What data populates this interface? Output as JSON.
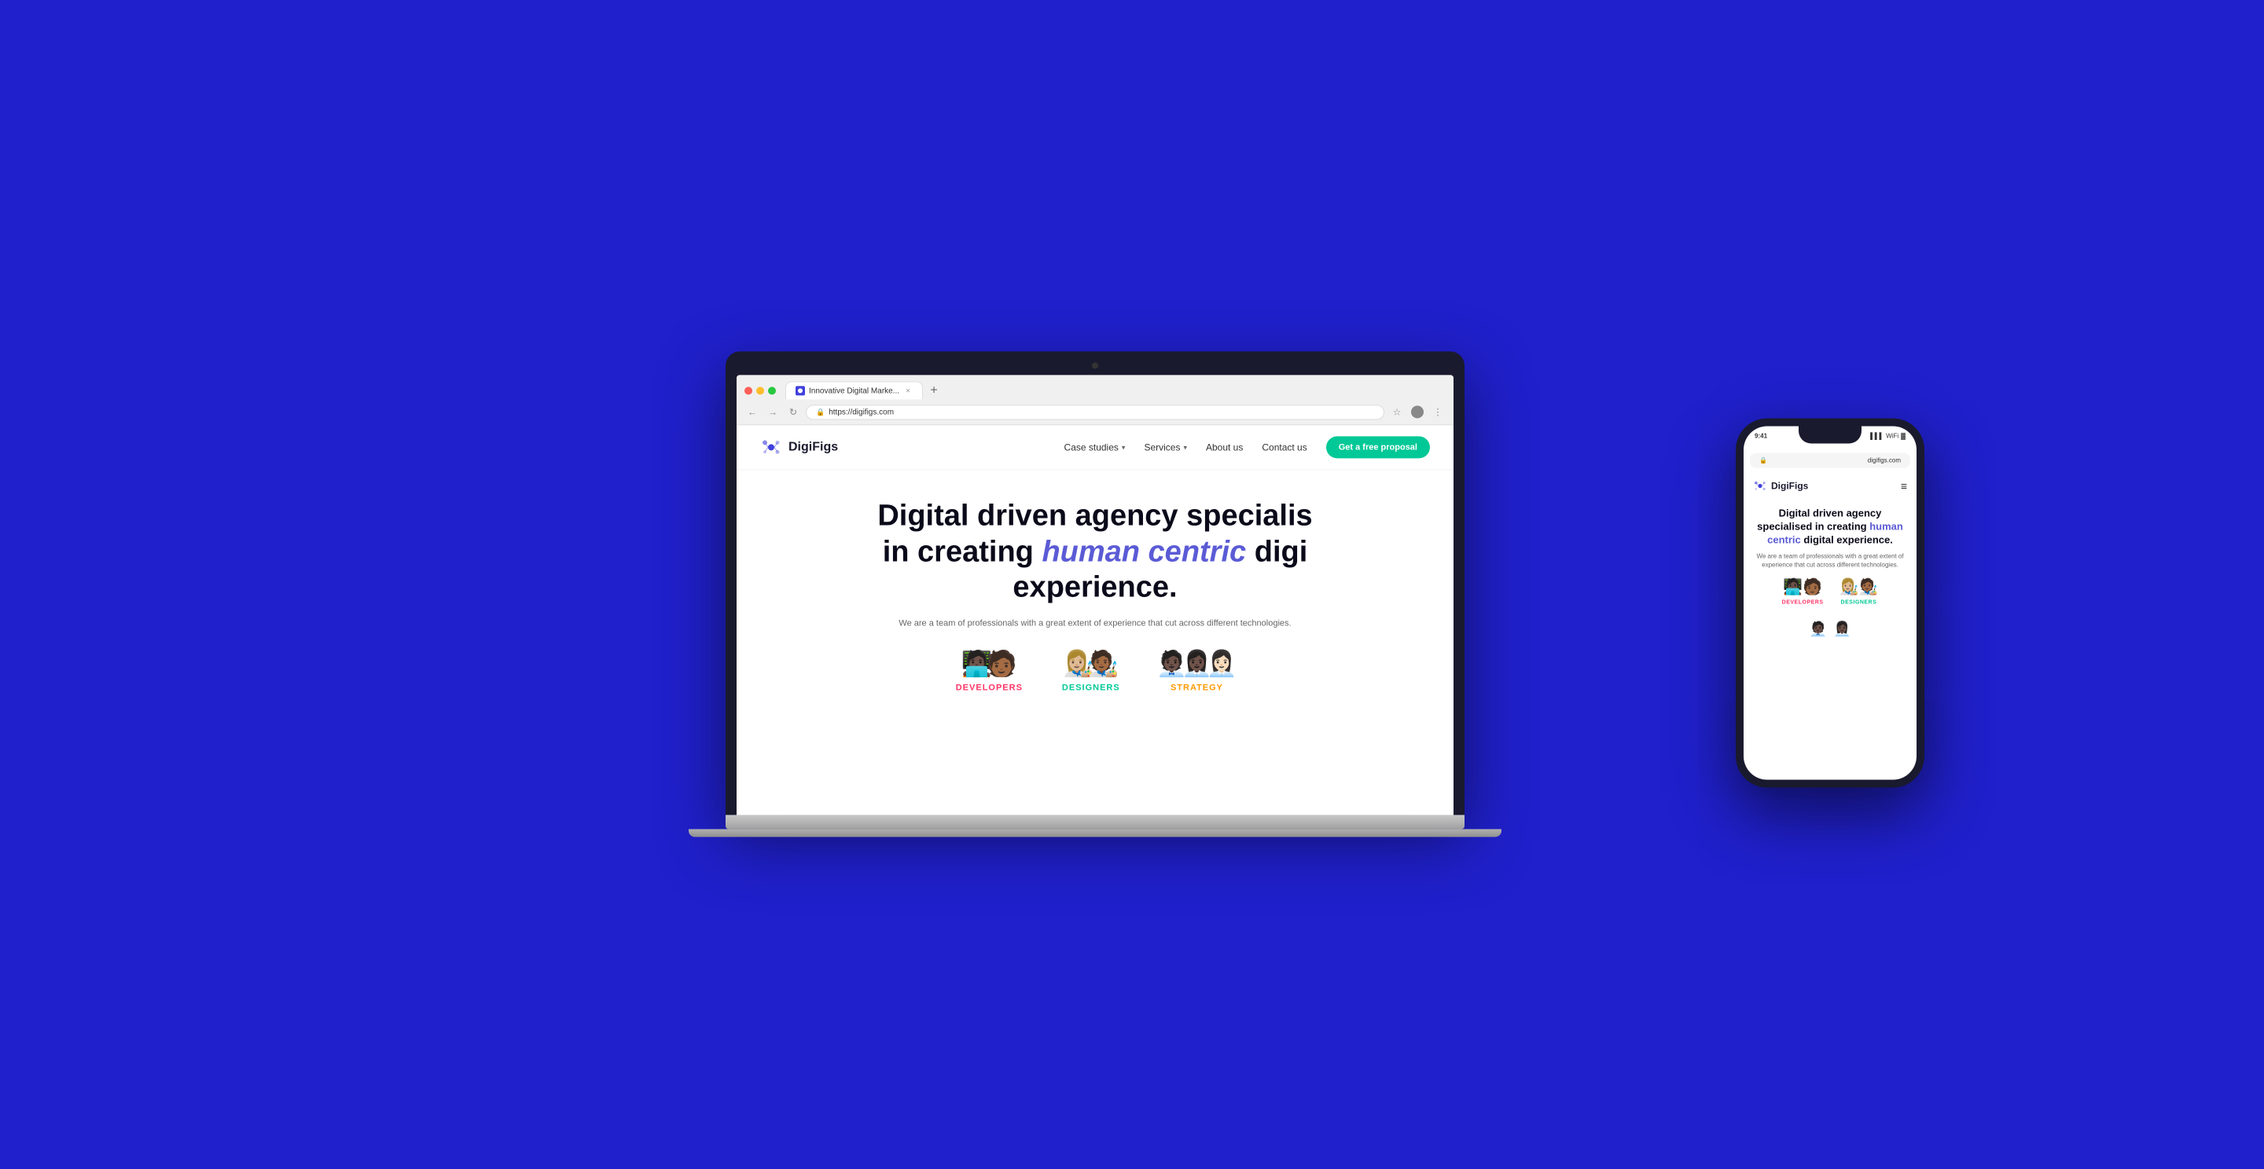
{
  "background": {
    "color": "#2020cc"
  },
  "browser": {
    "tab_title": "Innovative Digital Marke...",
    "url": "https://digifigs.com",
    "favicon": "🔷"
  },
  "website": {
    "logo_text": "DigiFigs",
    "nav": {
      "links": [
        {
          "label": "Case studies",
          "has_dropdown": true
        },
        {
          "label": "Services",
          "has_dropdown": true
        },
        {
          "label": "About us",
          "has_dropdown": false
        },
        {
          "label": "Contact us",
          "has_dropdown": false
        }
      ],
      "cta": "Get a free proposal"
    },
    "hero": {
      "title_line1": "Digital driven agency specialis",
      "title_line2": "in creating ",
      "title_highlight": "human centric",
      "title_line3": " digi",
      "title_line4": "experience.",
      "subtitle": "We are a team of professionals with a great extent of experience that cut across different technologies.",
      "teams": [
        {
          "label": "DEVELOPERS",
          "avatars": [
            "🧑🏿‍💻",
            "🧑🏾"
          ],
          "color_class": "label-pink"
        },
        {
          "label": "DESIGNERS",
          "avatars": [
            "👩🏼‍🎨",
            "🧑🏾‍🎨"
          ],
          "color_class": "label-teal"
        },
        {
          "label": "STRATEGY",
          "avatars": [
            "🧑🏿‍💼",
            "👩🏿‍💼",
            "👩🏻‍💼"
          ],
          "color_class": "label-orange"
        }
      ]
    }
  },
  "phone": {
    "status_time": "9:41",
    "url": "digifigs.com",
    "logo_text": "DigiFigs",
    "hero": {
      "title": "Digital driven agency specialised in creating ",
      "highlight": "human centric",
      "title_end": " digital experience.",
      "subtitle": "We are a team of professionals with a great extent of experience that cut across different technologies.",
      "teams": [
        {
          "label": "DEVELOPERS",
          "avatars": [
            "🧑🏿‍💻",
            "🧑🏾"
          ],
          "color_class": "label-pink"
        },
        {
          "label": "DESIGNERS",
          "avatars": [
            "👩🏼‍🎨",
            "🧑🏾‍🎨"
          ],
          "color_class": "label-teal"
        }
      ]
    }
  }
}
